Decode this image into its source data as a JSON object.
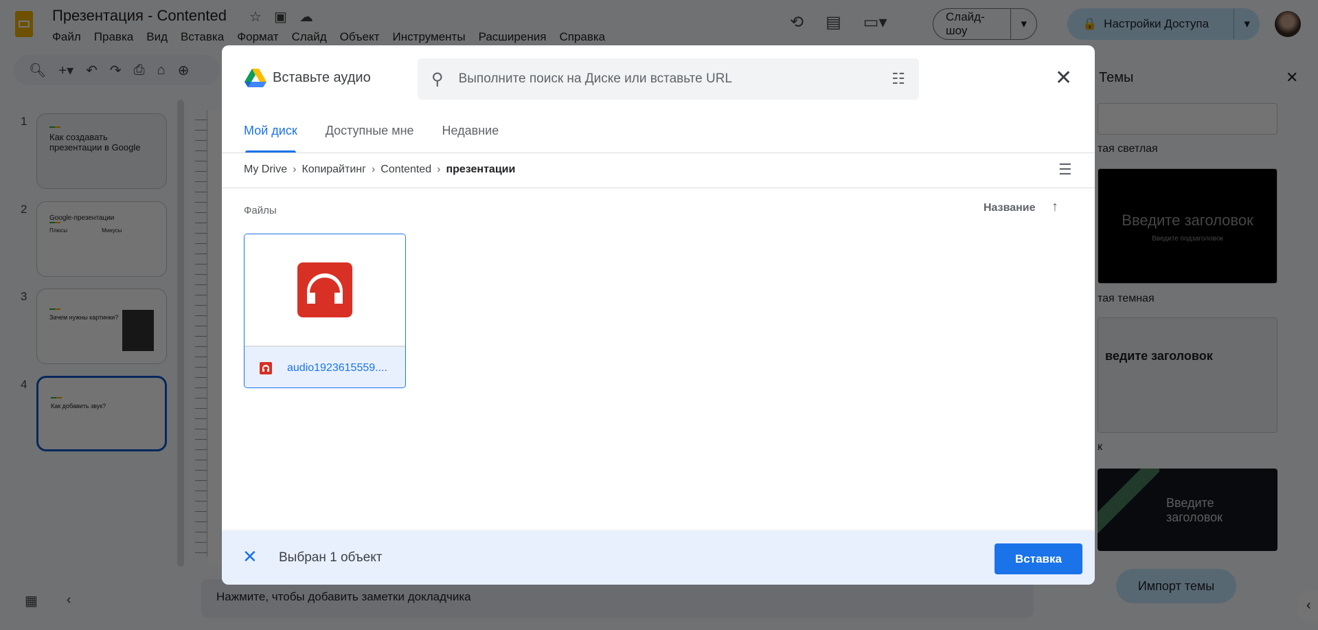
{
  "app": {
    "title": "Презентация - Contented",
    "menu": [
      "Файл",
      "Правка",
      "Вид",
      "Вставка",
      "Формат",
      "Слайд",
      "Объект",
      "Инструменты",
      "Расширения",
      "Справка"
    ],
    "slideshow": "Слайд-шоу",
    "share": "Настройки Доступа"
  },
  "slides": [
    {
      "num": "1",
      "title": "Как создавать презентации в Google"
    },
    {
      "num": "2",
      "title": "Google-презентации",
      "cols": [
        "Плюсы",
        "Минусы"
      ]
    },
    {
      "num": "3",
      "title": "Зачем нужны картинки?"
    },
    {
      "num": "4",
      "title": "Как добавить звук?"
    }
  ],
  "notes": "Нажмите, чтобы добавить заметки докладчика",
  "themes": {
    "title": "Темы",
    "labels": [
      "тая светлая",
      "тая темная",
      "к"
    ],
    "card_title": "Введите заголовок",
    "card_sub": "Введите подзаголовок",
    "card_title2": "ведите заголовок",
    "card_title3": "Введите заголовок",
    "import": "Импорт темы"
  },
  "dialog": {
    "title": "Вставьте аудио",
    "search_placeholder": "Выполните поиск на Диске или вставьте URL",
    "tabs": [
      "Мой диск",
      "Доступные мне",
      "Недавние"
    ],
    "breadcrumb": [
      "My Drive",
      "Копирайтинг",
      "Contented",
      "презентации"
    ],
    "files_label": "Файлы",
    "sort_label": "Название",
    "file": {
      "name": "audio1923615559...."
    },
    "selected": "Выбран 1 объект",
    "insert": "Вставка"
  },
  "colors": {
    "accent": "#1a73e8",
    "audio": "#d93025"
  }
}
